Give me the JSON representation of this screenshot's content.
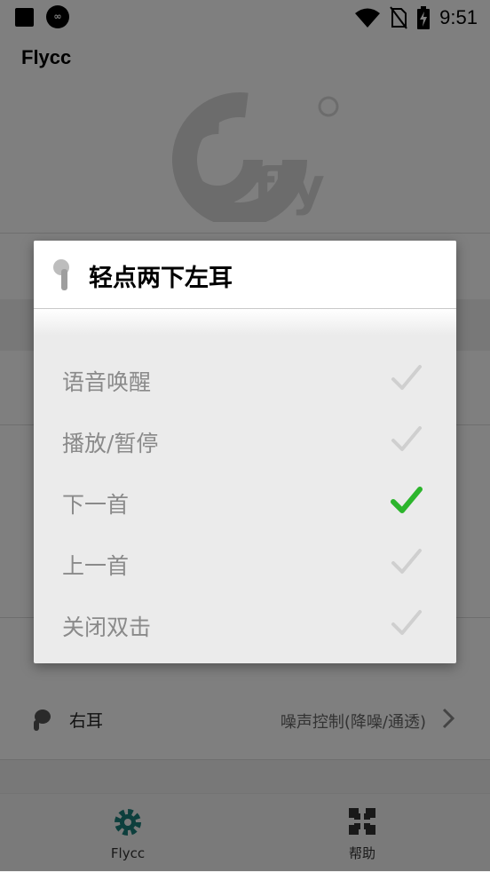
{
  "status_bar": {
    "time": "9:51",
    "icons": [
      "notification-square-icon",
      "app-notification-icon",
      "wifi-icon",
      "no-sim-icon",
      "battery-charging-icon"
    ]
  },
  "app": {
    "title": "Flycc",
    "rows": {
      "right_ear": {
        "label": "右耳",
        "value": "噪声控制(降噪/通透)"
      }
    },
    "bottom_nav": [
      {
        "label": "Flycc",
        "icon": "gear-icon",
        "color": "#1b7f7a"
      },
      {
        "label": "帮助",
        "icon": "help-puzzle-icon",
        "color": "#333333"
      }
    ]
  },
  "dialog": {
    "title": "轻点两下左耳",
    "icon": "left-earbud-icon",
    "options": [
      {
        "label": "语音唤醒",
        "selected": false
      },
      {
        "label": "播放/暂停",
        "selected": false
      },
      {
        "label": "下一首",
        "selected": true
      },
      {
        "label": "上一首",
        "selected": false
      },
      {
        "label": "关闭双击",
        "selected": false
      }
    ],
    "selected_color": "#2cb52c",
    "unselected_color": "#cfcfcf"
  }
}
